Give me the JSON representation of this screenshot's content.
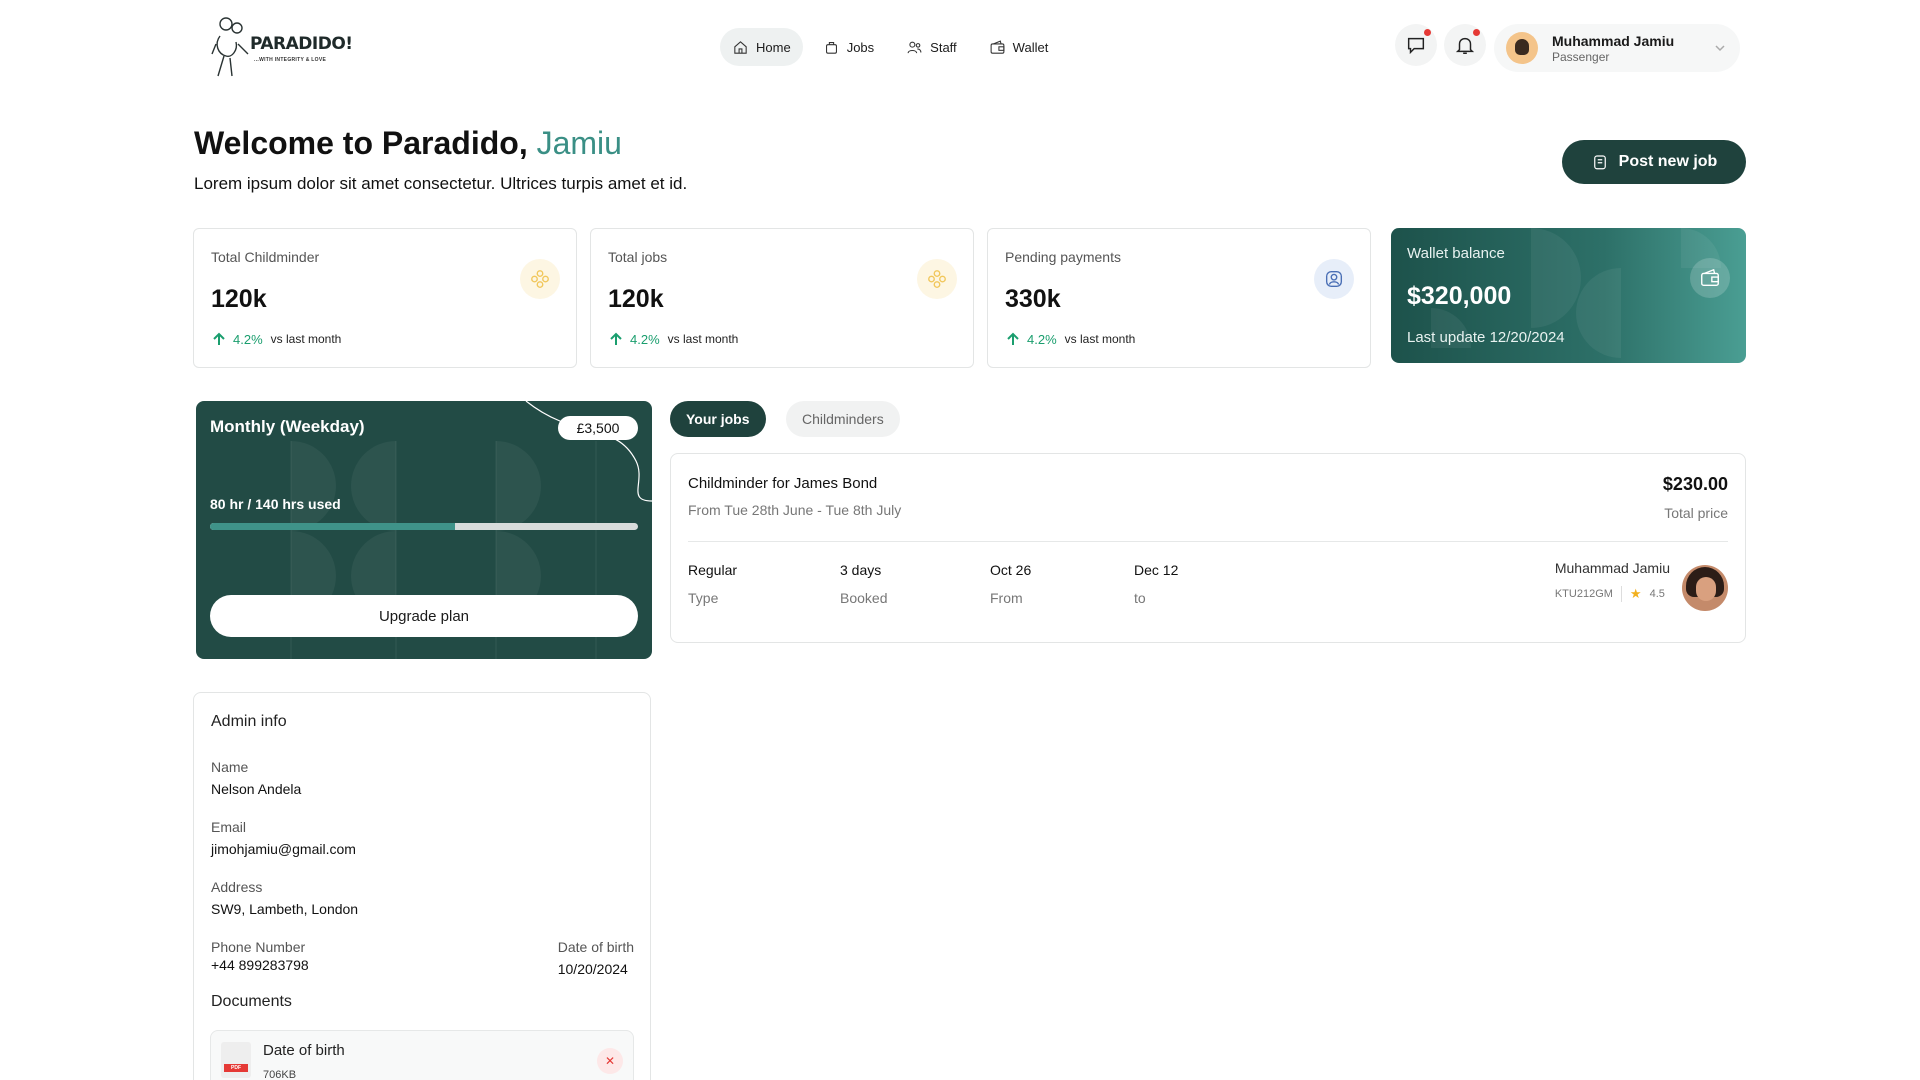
{
  "brand": {
    "name": "PARADIDO!",
    "tagline": "...WITH INTEGRITY & LOVE"
  },
  "nav": [
    {
      "label": "Home",
      "icon": "home-icon",
      "active": true
    },
    {
      "label": "Jobs",
      "icon": "briefcase-icon",
      "active": false
    },
    {
      "label": "Staff",
      "icon": "users-icon",
      "active": false
    },
    {
      "label": "Wallet",
      "icon": "wallet-icon",
      "active": false
    }
  ],
  "user": {
    "name": "Muhammad Jamiu",
    "role": "Passenger"
  },
  "welcome": {
    "prefix": "Welcome to Paradido,",
    "name": "Jamiu",
    "subtitle": "Lorem ipsum dolor sit amet consectetur. Ultrices turpis amet et id."
  },
  "post_job_label": "Post new job",
  "stats": [
    {
      "label": "Total Childminder",
      "value": "120k",
      "change": "4.2%",
      "period": "vs last month",
      "icon": "flower-icon"
    },
    {
      "label": "Total jobs",
      "value": "120k",
      "change": "4.2%",
      "period": "vs last month",
      "icon": "flower-icon"
    },
    {
      "label": "Pending payments",
      "value": "330k",
      "change": "4.2%",
      "period": "vs last month",
      "icon": "user-card-icon"
    }
  ],
  "wallet": {
    "label": "Wallet balance",
    "value": "$320,000",
    "updated": "Last update 12/20/2024",
    "icon": "wallet-icon"
  },
  "plan": {
    "title": "Monthly (Weekday)",
    "price": "£3,500",
    "usage": "80 hr / 140 hrs used",
    "used_hours": 80,
    "total_hours": 140,
    "upgrade_label": "Upgrade plan"
  },
  "tabs": [
    {
      "label": "Your jobs",
      "active": true
    },
    {
      "label": "Childminders",
      "active": false
    }
  ],
  "job": {
    "title": "Childminder for James Bond",
    "dates": "From Tue 28th June - Tue 8th July",
    "price": "$230.00",
    "price_label": "Total price",
    "details": [
      {
        "value": "Regular",
        "label": "Type"
      },
      {
        "value": "3 days",
        "label": "Booked"
      },
      {
        "value": "Oct 26",
        "label": "From"
      },
      {
        "value": "Dec 12",
        "label": "to"
      }
    ],
    "assignee": {
      "name": "Muhammad Jamiu",
      "code": "KTU212GM",
      "rating": "4.5"
    }
  },
  "admin": {
    "heading": "Admin info",
    "fields": [
      {
        "label": "Name",
        "value": "Nelson Andela"
      },
      {
        "label": "Email",
        "value": "jimohjamiu@gmail.com"
      },
      {
        "label": "Address",
        "value": "SW9, Lambeth, London"
      },
      {
        "label": "Phone Number",
        "value": "+44 899283798"
      }
    ],
    "dob": {
      "label": "Date of birth",
      "value": "10/20/2024"
    },
    "documents_heading": "Documents",
    "document": {
      "name": "Date of birth",
      "size": "706KB",
      "type": "PDF"
    }
  },
  "colors": {
    "primary": "#1f423d",
    "accent": "#3a8f85",
    "success": "#1a9e6e",
    "danger": "#e53935"
  }
}
